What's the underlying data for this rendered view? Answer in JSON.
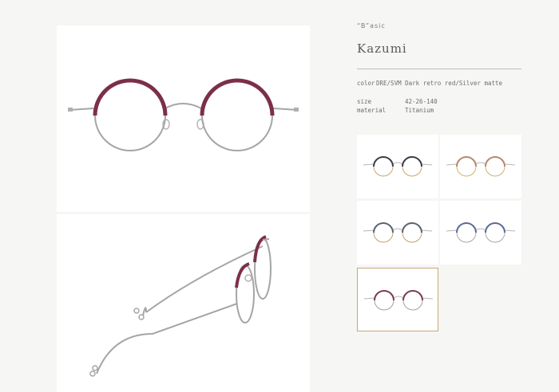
{
  "product": {
    "collection": "“B”asic",
    "name": "Kazumi",
    "color_label": "color",
    "color_value": "DRE/SVM Dark retro red/Silver matte",
    "size_label": "size",
    "size_value": "42-26-140",
    "material_label": "material",
    "material_value": "Titanium"
  },
  "images": {
    "front": "front view glasses image",
    "side": "side view glasses image"
  },
  "variants": [
    {
      "rim": "#3c3c4a",
      "lower": "#c9a868",
      "selected": false
    },
    {
      "rim": "#b48870",
      "lower": "#d2b070",
      "selected": false
    },
    {
      "rim": "#5e6270",
      "lower": "#c3a06a",
      "selected": false
    },
    {
      "rim": "#5c6a96",
      "lower": "#a8a8ac",
      "selected": false
    },
    {
      "rim": "#7c3a52",
      "lower": "#a0a0a6",
      "selected": true
    }
  ],
  "colors": {
    "frame_rim": "#7c2f49",
    "frame_silver": "#a5a5a9",
    "selected_border": "#c9a77a"
  }
}
